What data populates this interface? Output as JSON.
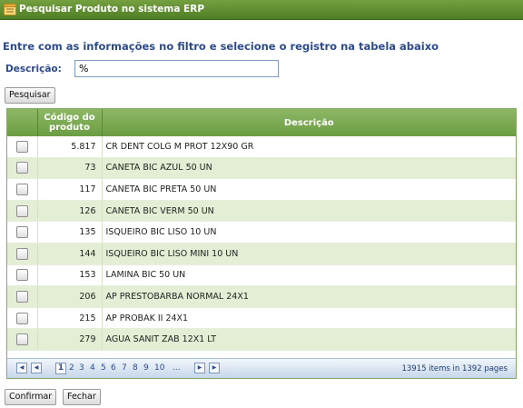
{
  "window": {
    "title": "Pesquisar Produto no sistema ERP"
  },
  "instructions": "Entre com as informações no filtro e selecione o registro na tabela abaixo",
  "filter": {
    "label": "Descrição:",
    "value": "%"
  },
  "buttons": {
    "search": "Pesquisar",
    "confirm": "Confirmar",
    "close": "Fechar"
  },
  "table": {
    "headers": {
      "code_line1": "Código do",
      "code_line2": "produto",
      "description": "Descrição"
    },
    "rows": [
      {
        "code": "5.817",
        "description": "CR DENT COLG M PROT 12X90 GR"
      },
      {
        "code": "73",
        "description": "CANETA BIC AZUL 50 UN"
      },
      {
        "code": "117",
        "description": "CANETA BIC PRETA 50 UN"
      },
      {
        "code": "126",
        "description": "CANETA BIC VERM 50 UN"
      },
      {
        "code": "135",
        "description": "ISQUEIRO BIC LISO 10 UN"
      },
      {
        "code": "144",
        "description": "ISQUEIRO BIC LISO MINI 10 UN"
      },
      {
        "code": "153",
        "description": "LAMINA BIC 50 UN"
      },
      {
        "code": "206",
        "description": "AP PRESTOBARBA NORMAL 24X1"
      },
      {
        "code": "215",
        "description": "AP PROBAK II 24X1"
      },
      {
        "code": "279",
        "description": "AGUA SANIT ZAB 12X1 LT"
      }
    ]
  },
  "pager": {
    "current_page": "1",
    "pages": [
      "2",
      "3",
      "4",
      "5",
      "6",
      "7",
      "8",
      "9",
      "10",
      "..."
    ],
    "info": "13915 items in 1392 pages",
    "icons": [
      "first-page-icon",
      "prev-page-icon",
      "next-page-icon",
      "last-page-icon"
    ]
  },
  "colors": {
    "title_bar": "#5a8a2e",
    "header": "#7cab54",
    "alt_row": "#e3eed4",
    "label_blue": "#2d4b8c"
  }
}
